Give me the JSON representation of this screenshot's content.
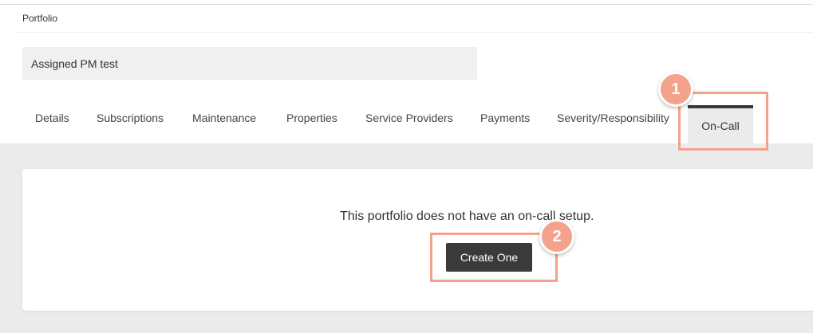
{
  "breadcrumb": "Portfolio",
  "portfolio_name": "Assigned PM test",
  "tabs": [
    {
      "label": "Details"
    },
    {
      "label": "Subscriptions"
    },
    {
      "label": "Maintenance"
    },
    {
      "label": "Properties"
    },
    {
      "label": "Service Providers"
    },
    {
      "label": "Payments"
    },
    {
      "label": "Severity/Responsibility"
    },
    {
      "label": "On-Call",
      "active": true
    }
  ],
  "main": {
    "empty_message": "This portfolio does not have an on-call setup.",
    "create_button_label": "Create One"
  },
  "annotations": [
    {
      "number": "1"
    },
    {
      "number": "2"
    }
  ],
  "colors": {
    "annotation": "#f4a28c",
    "active_tab_border": "#3a3a3a",
    "button_bg": "#3a3a3a",
    "page_bg": "#ebebeb"
  }
}
